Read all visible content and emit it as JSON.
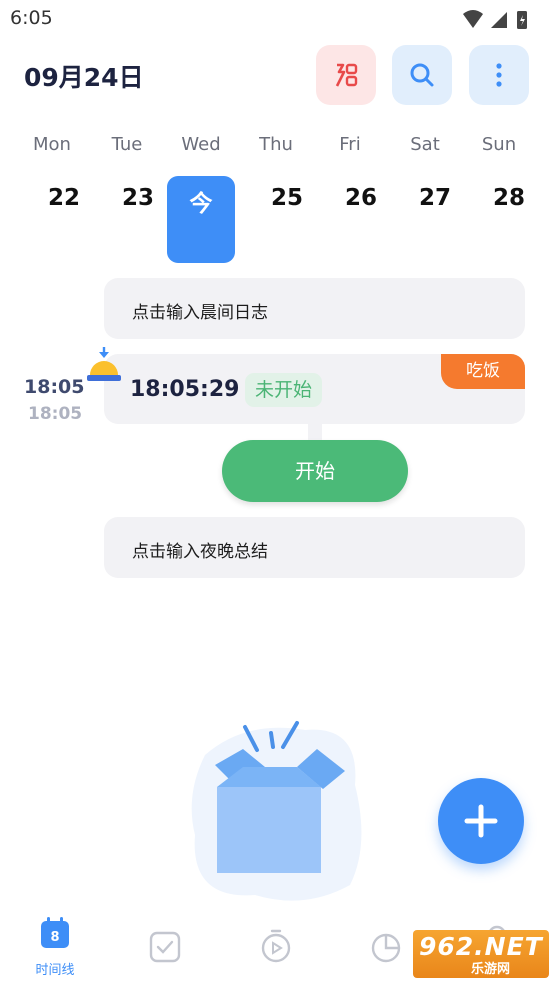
{
  "status_bar": {
    "time": "6:05"
  },
  "header": {
    "date": "09月24日"
  },
  "week": {
    "labels": [
      "Mon",
      "Tue",
      "Wed",
      "Thu",
      "Fri",
      "Sat",
      "Sun"
    ],
    "days": [
      "22",
      "23",
      "今",
      "25",
      "26",
      "27",
      "28"
    ],
    "selected_index": 2
  },
  "timeline": {
    "morning_prompt": "点击输入晨间日志",
    "event": {
      "time_main": "18:05",
      "time_sub": "18:05",
      "clock": "18:05:29",
      "status": "未开始",
      "tag": "吃饭"
    },
    "start_button": "开始",
    "evening_prompt": "点击输入夜晚总结"
  },
  "bottom_nav": {
    "tabs": [
      {
        "icon": "calendar-icon",
        "label": "时间线",
        "badge": "8",
        "active": true
      },
      {
        "icon": "checkbox-icon",
        "label": ""
      },
      {
        "icon": "timer-icon",
        "label": ""
      },
      {
        "icon": "pie-chart-icon",
        "label": ""
      },
      {
        "icon": "profile-icon",
        "label": ""
      }
    ]
  },
  "watermark": {
    "text": "962.NET",
    "sub": "乐游网"
  },
  "colors": {
    "accent": "#3e8ef7",
    "start_green": "#4bba78",
    "status_green": "#4bb475",
    "tag_orange": "#f57a2e",
    "red_icon": "#e84a4a"
  }
}
